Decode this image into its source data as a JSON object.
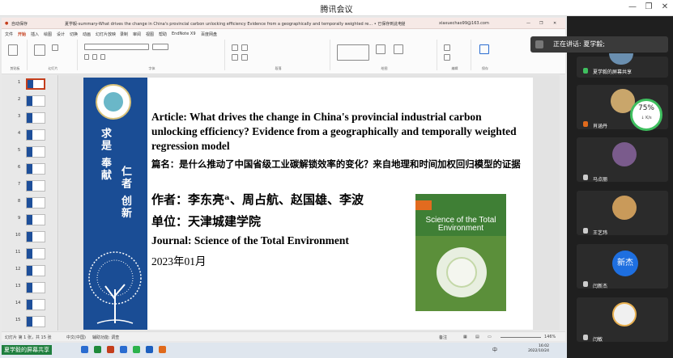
{
  "meeting": {
    "title": "腾讯会议"
  },
  "ppt": {
    "autosave": "自动保存",
    "doc_title": "夏学毅-summary-What drives the change in China's provincial carbon unlocking efficiency Evidence from a geographically and temporally weighted re... • 已保存到此电脑 ∨",
    "account": "xiaxuechao99@163.com",
    "menu": [
      "文件",
      "开始",
      "插入",
      "绘图",
      "设计",
      "切换",
      "动画",
      "幻灯片放映",
      "录制",
      "审阅",
      "视图",
      "帮助",
      "EndNote X9",
      "百度网盘"
    ],
    "ribbon_groups": [
      "剪贴板",
      "幻灯片",
      "字体",
      "段落",
      "绘图",
      "编辑",
      "保存"
    ],
    "status_left": "幻灯片 第 1 张，共 15 张",
    "status_lang": "中文(中国)",
    "status_access": "辅助功能: 调查",
    "status_notes": "备注",
    "zoom": "146%"
  },
  "thumbs": [
    "1",
    "2",
    "3",
    "4",
    "5",
    "6",
    "7",
    "8",
    "9",
    "10",
    "11",
    "12",
    "13",
    "14",
    "15"
  ],
  "slide": {
    "article_en": "Article:  What drives the change in China's provincial industrial carbon unlocking efficiency? Evidence from a geographically and temporally weighted regression model",
    "article_cn": "篇名：是什么推动了中国省级工业碳解锁效率的变化？来自地理和时间加权回归模型的证据",
    "authors": "作者：李东亮ᵃ、周占航、赵国雄、李波",
    "unit": "单位：天津城建学院",
    "journal": "Journal:  Science of the Total Environment",
    "date": "2023年01月",
    "calli_1": "求是 奉献",
    "calli_2": "仁者 创新",
    "cover_title": "Science of the Total Environment"
  },
  "taskbar": {
    "share_label": "夏学毅的屏幕共享",
    "time": "16:02",
    "date": "2022/10/24",
    "ime": "中"
  },
  "panel": {
    "speaking_label": "正在讲话: 夏学毅;",
    "participants": [
      {
        "name": "夏学毅的屏幕共享",
        "color": "#6a8fb0"
      },
      {
        "name": "肖涵丹",
        "color": "#c9a66b"
      },
      {
        "name": "马点丽",
        "color": "#7a5b8c"
      },
      {
        "name": "王艺玮",
        "color": "#c99a5a"
      },
      {
        "name": "闫新杰",
        "color": "#1e6fe0",
        "initials": "新杰"
      },
      {
        "name": "闫敏",
        "color": "#f0f0f0"
      }
    ],
    "network": {
      "value": "75%",
      "speed": "↓ K/s"
    }
  }
}
